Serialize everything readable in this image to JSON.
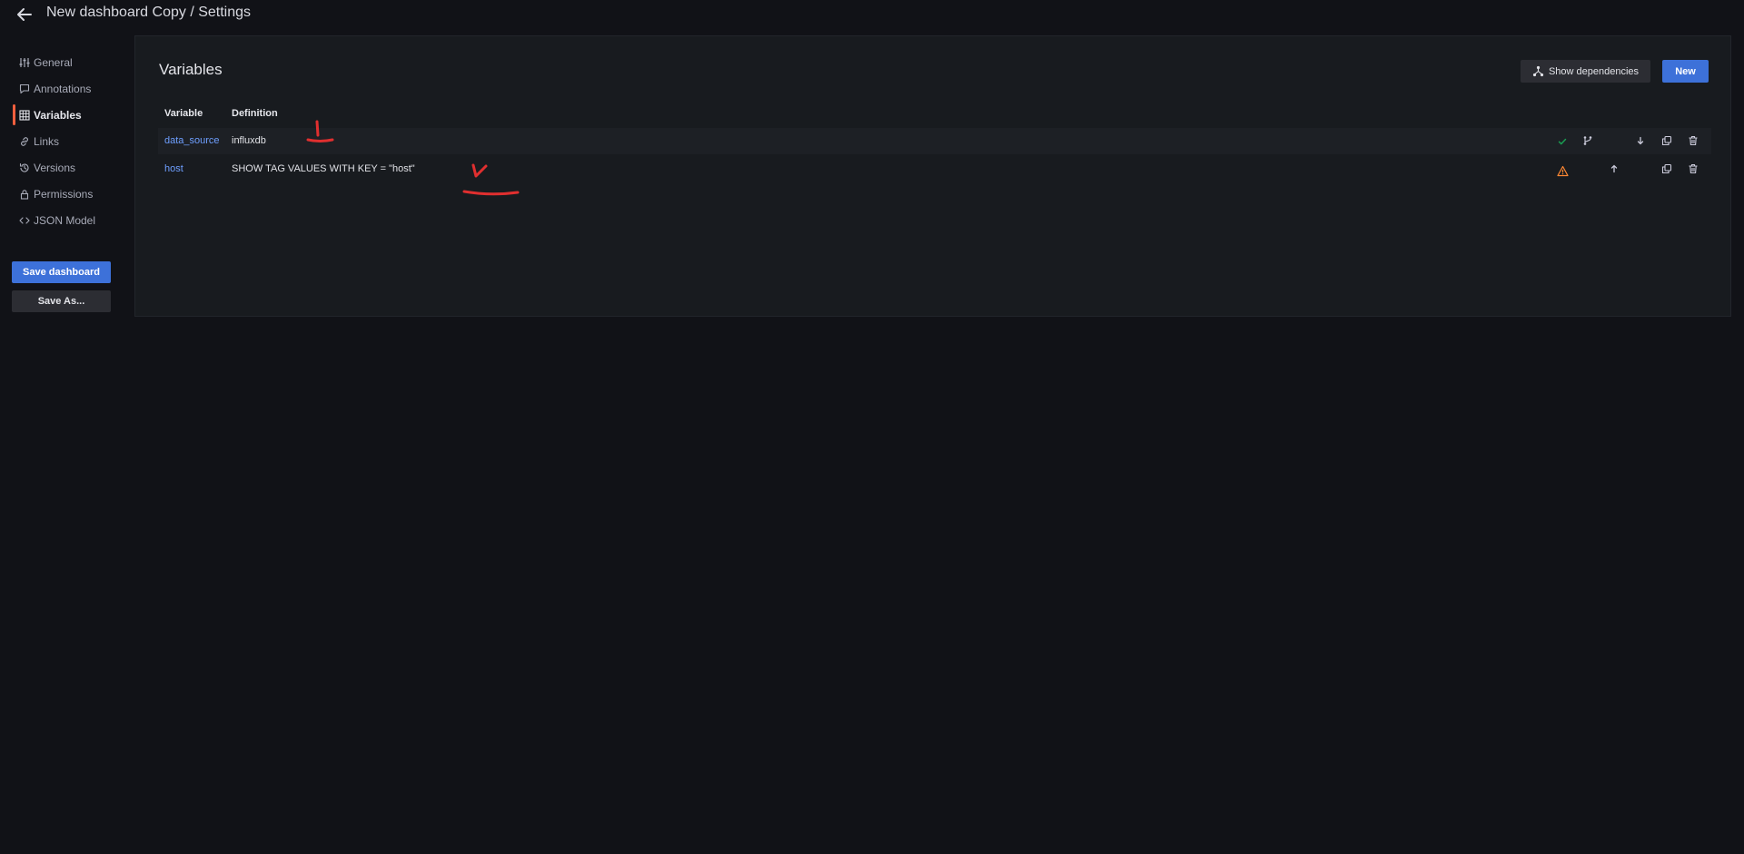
{
  "header": {
    "title": "New dashboard Copy / Settings"
  },
  "sidebar": {
    "items": [
      {
        "label": "General",
        "icon": "sliders-icon"
      },
      {
        "label": "Annotations",
        "icon": "comment-icon"
      },
      {
        "label": "Variables",
        "icon": "grid-icon",
        "active": true
      },
      {
        "label": "Links",
        "icon": "link-icon"
      },
      {
        "label": "Versions",
        "icon": "history-icon"
      },
      {
        "label": "Permissions",
        "icon": "lock-icon"
      },
      {
        "label": "JSON Model",
        "icon": "code-icon"
      }
    ],
    "save_label": "Save dashboard",
    "save_as_label": "Save As..."
  },
  "panel": {
    "title": "Variables",
    "show_dependencies_label": "Show dependencies",
    "new_label": "New",
    "columns": [
      "Variable",
      "Definition"
    ],
    "rows": [
      {
        "name": "data_source",
        "definition": "influxdb",
        "status": "ok",
        "actions": [
          "dependency-icon",
          "arrow-down-icon",
          "duplicate-icon",
          "trash-icon"
        ]
      },
      {
        "name": "host",
        "definition": "SHOW TAG VALUES WITH KEY = \"host\"",
        "status": "warning",
        "actions": [
          "arrow-up-icon",
          "duplicate-icon",
          "trash-icon"
        ]
      }
    ]
  },
  "colors": {
    "accent": "#3d71d9",
    "link": "#6e9fff",
    "active_marker": "#f55f3e",
    "ok": "#1a9c52",
    "warning": "#ff8833",
    "annotation": "#e02f2f"
  }
}
